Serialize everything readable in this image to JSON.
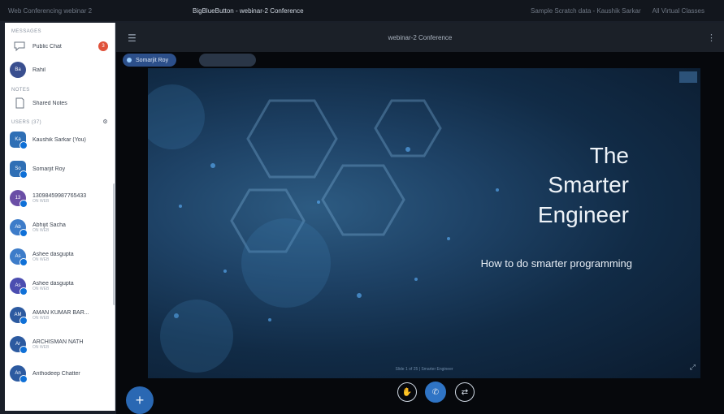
{
  "topbar": {
    "tabs": [
      "Web Conferencing webinar 2",
      "BigBlueButton - webinar-2 Conference",
      "Sample Scratch data - Kaushik Sarkar",
      "All Virtual Classes"
    ]
  },
  "sidebar": {
    "messages_title": "MESSAGES",
    "public_chat": "Public Chat",
    "unread_count": "3",
    "private_chat_avatar": "Ba",
    "private_chat_name": "Rahil",
    "notes_title": "NOTES",
    "shared_notes": "Shared Notes",
    "users_title": "USERS (37)",
    "users": [
      {
        "initials": "Ka",
        "name": "Kaushik Sarkar (You)",
        "sub": "",
        "color": "#2f6fb5",
        "square": true
      },
      {
        "initials": "So",
        "name": "Somarjit Roy",
        "sub": "",
        "color": "#2f6fb5",
        "square": true
      },
      {
        "initials": "13",
        "name": "13098459987765433",
        "sub": "ON WEB",
        "color": "#6a4ea6",
        "square": false
      },
      {
        "initials": "Ab",
        "name": "Abhijit Sacha",
        "sub": "ON WEB",
        "color": "#3d7cc9",
        "square": false
      },
      {
        "initials": "As",
        "name": "Ashee dasgupta",
        "sub": "ON WEB",
        "color": "#3d7cc9",
        "square": false
      },
      {
        "initials": "As",
        "name": "Ashee dasgupta",
        "sub": "ON WEB",
        "color": "#4b4db0",
        "square": false
      },
      {
        "initials": "AM",
        "name": "AMAN KUMAR BAR...",
        "sub": "ON WEB",
        "color": "#2c5aa0",
        "square": false
      },
      {
        "initials": "Ar",
        "name": "ARCHISMAN NATH",
        "sub": "ON WEB",
        "color": "#2c5aa0",
        "square": false
      },
      {
        "initials": "An",
        "name": "Anthodeep Chatter",
        "sub": "",
        "color": "#2c5aa0",
        "square": false
      }
    ]
  },
  "main": {
    "conference_title": "webinar-2 Conference",
    "presenter_name": "Somarjit Roy",
    "slide": {
      "title_line1": "The",
      "title_line2": "Smarter",
      "title_line3": "Engineer",
      "subtitle": "How to do smarter programming",
      "footer": "Slide 1 of 25 | Smarter Engineer"
    }
  },
  "controls": {
    "fab": "+",
    "hand": "✋",
    "phone": "✆",
    "share": "⇄"
  }
}
